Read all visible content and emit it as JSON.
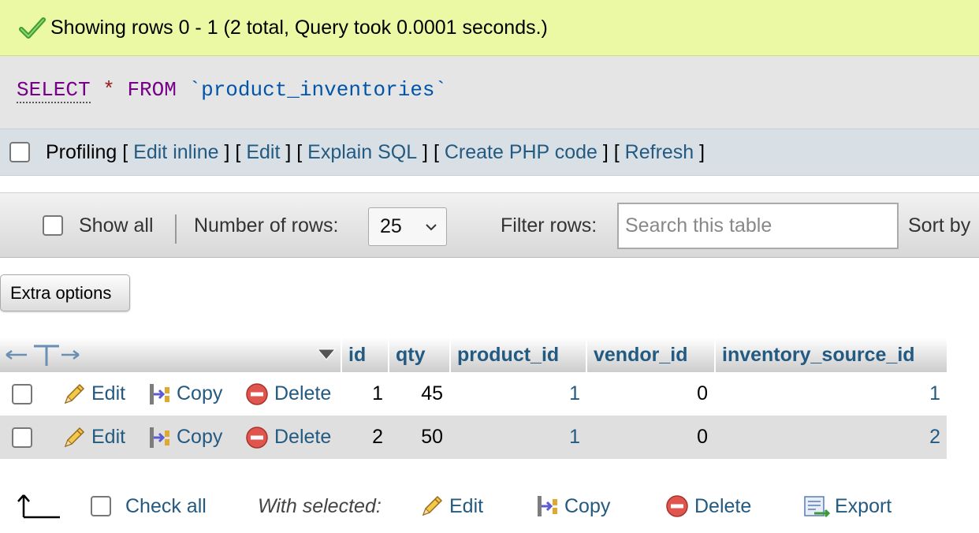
{
  "success": {
    "message": "Showing rows 0 - 1 (2 total, Query took 0.0001 seconds.)"
  },
  "sql": {
    "select": "SELECT",
    "star": "*",
    "from": "FROM",
    "table": "`product_inventories`"
  },
  "profiling": {
    "label": "Profiling",
    "links": [
      "Edit inline",
      "Edit",
      "Explain SQL",
      "Create PHP code",
      "Refresh"
    ]
  },
  "navigation": {
    "show_all": "Show all",
    "rows_label": "Number of rows:",
    "rows_value": "25",
    "filter_label": "Filter rows:",
    "search_placeholder": "Search this table",
    "sort_label": "Sort by"
  },
  "extra_options": "Extra options",
  "table": {
    "columns": [
      "id",
      "qty",
      "product_id",
      "vendor_id",
      "inventory_source_id"
    ],
    "actions": {
      "edit": "Edit",
      "copy": "Copy",
      "delete": "Delete"
    },
    "rows": [
      {
        "id": "1",
        "qty": "45",
        "product_id": "1",
        "vendor_id": "0",
        "inventory_source_id": "1"
      },
      {
        "id": "2",
        "qty": "50",
        "product_id": "1",
        "vendor_id": "0",
        "inventory_source_id": "2"
      }
    ]
  },
  "bottom": {
    "check_all": "Check all",
    "with_selected": "With selected:",
    "edit": "Edit",
    "copy": "Copy",
    "delete": "Delete",
    "export": "Export"
  },
  "colors": {
    "link": "#235a81",
    "success_bg": "#ebf8a4",
    "sql_bg": "#e5e5e5",
    "profiling_bg": "#d8e0e6"
  },
  "icons": [
    "check-icon",
    "chevron-down-icon",
    "column-arrows-icon",
    "sort-triangle-icon",
    "pencil-icon",
    "copy-icon",
    "delete-icon",
    "arrow-up-left-icon",
    "export-icon"
  ]
}
